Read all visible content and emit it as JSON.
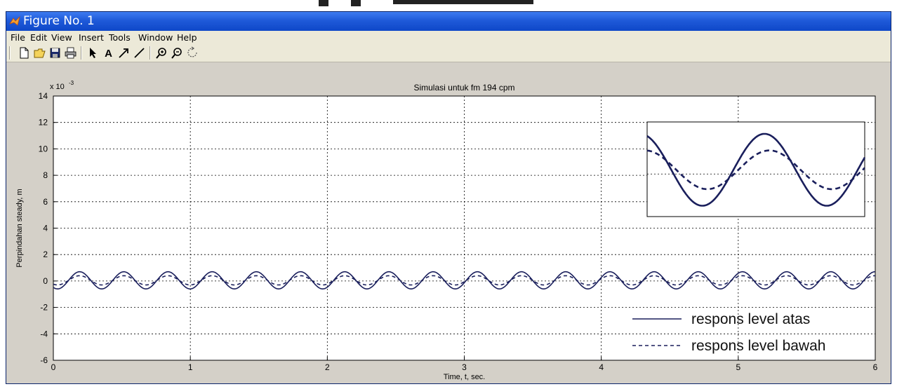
{
  "window": {
    "title": "Figure No. 1",
    "menu": [
      "File",
      "Edit",
      "View",
      "Insert",
      "Tools",
      "Window",
      "Help"
    ],
    "toolbar_icons": [
      "new-file-icon",
      "open-folder-icon",
      "save-icon",
      "print-icon",
      "arrow-select-icon",
      "text-tool-icon",
      "arrow-tool-icon",
      "line-tool-icon",
      "zoom-in-icon",
      "zoom-out-icon",
      "rotate-icon"
    ]
  },
  "chart_data": {
    "type": "line",
    "title": "Simulasi untuk fm 194 cpm",
    "xlabel": "Time, t, sec.",
    "ylabel": "Perpindahan steady, m",
    "y_exponent_label": "x 10",
    "y_exponent_power": "-3",
    "xlim": [
      0,
      6
    ],
    "ylim": [
      -6,
      14
    ],
    "x_ticks": [
      0,
      1,
      2,
      3,
      4,
      5,
      6
    ],
    "y_ticks": [
      -6,
      -4,
      -2,
      0,
      2,
      4,
      6,
      8,
      10,
      12,
      14
    ],
    "grid": true,
    "legend_position": "bottom-right",
    "frequency_hz": 3.1,
    "series": [
      {
        "name": "respons level atas",
        "style": "solid",
        "amplitude": 0.65,
        "offset": 0.05,
        "color": "#1a1f5c"
      },
      {
        "name": "respons level bawah",
        "style": "dashed",
        "amplitude": 0.35,
        "offset": 0.05,
        "color": "#1a1f5c"
      }
    ],
    "inset": {
      "description_position": "top-right",
      "shows": "zoom of both series"
    }
  }
}
